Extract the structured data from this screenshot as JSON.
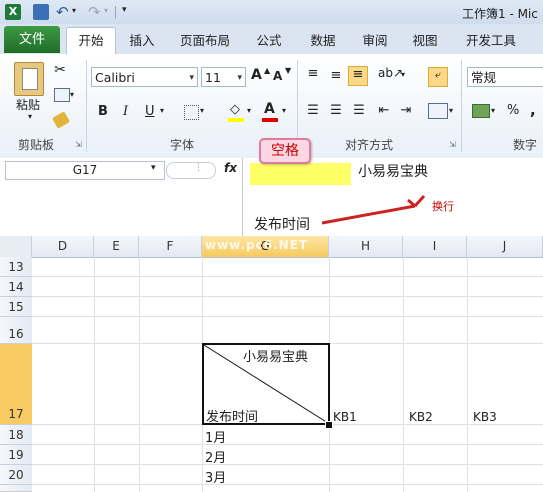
{
  "title": "工作簿1 - Mic",
  "qat": {
    "undo": "↶",
    "redo": "↷"
  },
  "tabs": [
    "文件",
    "开始",
    "插入",
    "页面布局",
    "公式",
    "数据",
    "审阅",
    "视图",
    "开发工具"
  ],
  "clipboard": {
    "paste": "粘贴",
    "label": "剪贴板"
  },
  "font": {
    "name": "Calibri",
    "size": "11",
    "label": "字体",
    "bold": "B",
    "italic": "I",
    "underline": "U",
    "grow": "A",
    "shrink": "A"
  },
  "alignment": {
    "label": "对齐方式"
  },
  "number": {
    "format": "常规",
    "label": "数字",
    "percent": "%",
    "comma": ","
  },
  "formula_bar": {
    "cell_ref": "G17",
    "fx": "fx",
    "line1": "小易易宝典",
    "line2": "发布时间"
  },
  "annotations": {
    "space_callout": "空格",
    "newline_note": "换行",
    "watermark": "www.pc6.NET"
  },
  "grid": {
    "columns": [
      "D",
      "E",
      "F",
      "G",
      "H",
      "I",
      "J"
    ],
    "rows": [
      "13",
      "14",
      "15",
      "16",
      "17",
      "18",
      "19",
      "20"
    ],
    "g17_top": "小易易宝典",
    "g17_bottom": "发布时间",
    "h17": "KB1",
    "i17": "KB2",
    "j17": "KB3",
    "g18": "1月",
    "g19": "2月",
    "g20": "3月"
  }
}
